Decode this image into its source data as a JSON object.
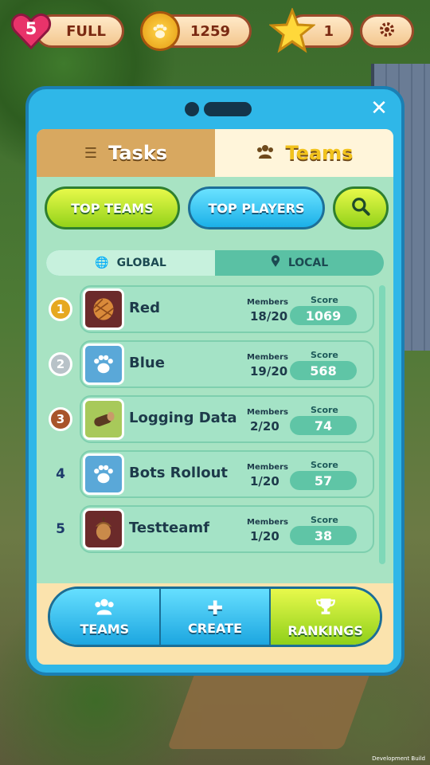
{
  "hud": {
    "lives_count": "5",
    "lives_status": "FULL",
    "coins": "1259",
    "stars": "1"
  },
  "panel": {
    "tabs": [
      {
        "label": "Tasks",
        "icon": "list-icon"
      },
      {
        "label": "Teams",
        "icon": "people-icon"
      }
    ],
    "buttons": {
      "top_teams": "TOP TEAMS",
      "top_players": "TOP PLAYERS"
    },
    "segments": {
      "global": "GLOBAL",
      "local": "LOCAL"
    },
    "column_labels": {
      "members": "Members",
      "score": "Score"
    },
    "teams": [
      {
        "rank": "1",
        "name": "Red",
        "members": "18/20",
        "score": "1069",
        "avatar": "pinecone-icon"
      },
      {
        "rank": "2",
        "name": "Blue",
        "members": "19/20",
        "score": "568",
        "avatar": "paw-icon"
      },
      {
        "rank": "3",
        "name": "Logging Data",
        "members": "2/20",
        "score": "74",
        "avatar": "log-icon"
      },
      {
        "rank": "4",
        "name": "Bots Rollout",
        "members": "1/20",
        "score": "57",
        "avatar": "paw-icon"
      },
      {
        "rank": "5",
        "name": "Testteamf",
        "members": "1/20",
        "score": "38",
        "avatar": "acorn-icon"
      }
    ],
    "bottom_nav": {
      "teams": "TEAMS",
      "create": "CREATE",
      "rankings": "RANKINGS"
    }
  },
  "footer": {
    "build_label": "Development Build"
  },
  "colors": {
    "panel_blue": "#2fb7e8",
    "accent_green": "#93d21a",
    "gold": "#e6a820",
    "silver": "#b8c2c8",
    "bronze": "#a8542a"
  }
}
